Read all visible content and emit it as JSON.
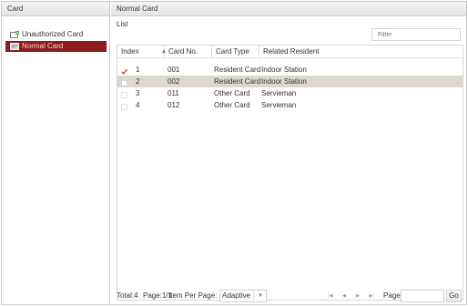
{
  "left_panel": {
    "title": "Card",
    "items": [
      {
        "label": "Unauthorized Card",
        "icon": "card-add-icon"
      },
      {
        "label": "Normal Card",
        "icon": "card-icon",
        "selected": true
      }
    ]
  },
  "right_panel": {
    "title": "Normal Card",
    "list_label": "List",
    "filter_placeholder": "Filter"
  },
  "table": {
    "columns": [
      "Index",
      "Card No.",
      "Card Type",
      "Related Resident"
    ],
    "sort_indicator": "▲",
    "rows": [
      {
        "index": "1",
        "card_no": "001",
        "card_type": "Resident Card",
        "resident": "Indoor Station",
        "checked": true
      },
      {
        "index": "2",
        "card_no": "002",
        "card_type": "Resident Card",
        "resident": "Indoor Station",
        "selected": true
      },
      {
        "index": "3",
        "card_no": "011",
        "card_type": "Other Card",
        "resident": "Servieman"
      },
      {
        "index": "4",
        "card_no": "012",
        "card_type": "Other Card",
        "resident": "Servieman"
      }
    ]
  },
  "footer": {
    "total": "Total:4",
    "page_info": "Page:1/1",
    "items_per_page_label": "Item Per Page:",
    "items_per_page_value": "Adaptive",
    "page_label": "Page",
    "go_label": "Go"
  },
  "colors": {
    "selected_tree_bg": "#8e1c1c",
    "selected_row_bg": "#dcd8cf",
    "check_mark": "#c0392b"
  }
}
